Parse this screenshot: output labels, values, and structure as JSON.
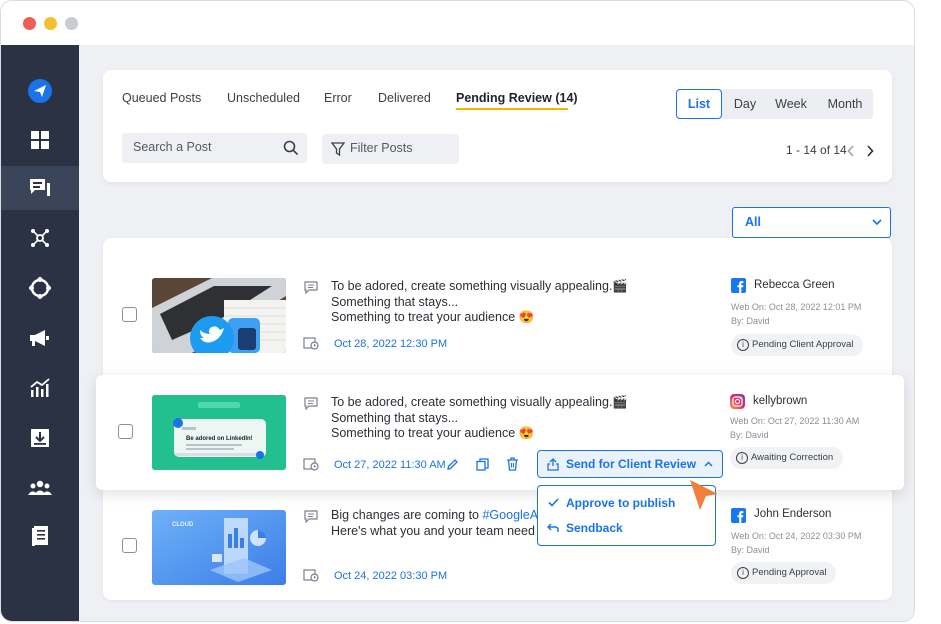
{
  "window": {
    "controls": {
      "close": "#ed5f57",
      "minimize": "#f5c02f",
      "zoom": "#c9ccd1"
    }
  },
  "sidebar": {
    "items": [
      {
        "icon": "send-icon",
        "active": false
      },
      {
        "icon": "dashboard-icon",
        "active": false
      },
      {
        "icon": "posts-icon",
        "active": true
      },
      {
        "icon": "network-icon",
        "active": false
      },
      {
        "icon": "compass-icon",
        "active": false
      },
      {
        "icon": "megaphone-icon",
        "active": false
      },
      {
        "icon": "analytics-icon",
        "active": false
      },
      {
        "icon": "inbox-download-icon",
        "active": false
      },
      {
        "icon": "team-icon",
        "active": false
      },
      {
        "icon": "document-icon",
        "active": false
      }
    ]
  },
  "tabs": [
    {
      "label": "Queued Posts",
      "active": false
    },
    {
      "label": "Unscheduled",
      "active": false
    },
    {
      "label": "Error",
      "active": false
    },
    {
      "label": "Delivered",
      "active": false
    },
    {
      "label": "Pending Review (14)",
      "active": true
    }
  ],
  "views": [
    {
      "label": "List",
      "active": true
    },
    {
      "label": "Day",
      "active": false
    },
    {
      "label": "Week",
      "active": false
    },
    {
      "label": "Month",
      "active": false
    }
  ],
  "search": {
    "placeholder": "Search a Post"
  },
  "filter": {
    "label": "Filter Posts"
  },
  "pagination": {
    "label": "1 - 14 of 14"
  },
  "account_filter": {
    "selected": "All"
  },
  "posts": [
    {
      "lines": [
        "To be adored, create something visually appealing.🎬",
        "Something that stays...",
        "Something to treat your audience 😍"
      ],
      "date": "Oct 28, 2022 12:30 PM",
      "network": "facebook",
      "account": "Rebecca Green",
      "web_on": "Web On: Oct 28, 2022 12:01 PM",
      "by": "By: David",
      "status": "Pending Client Approval"
    },
    {
      "lines": [
        "To be adored, create something visually appealing.🎬",
        "Something that stays...",
        "Something to treat your audience 😍"
      ],
      "date": "Oct 27, 2022 11:30 AM",
      "network": "instagram",
      "account": "kellybrown",
      "web_on": "Web On: Oct 27, 2022 11:30 AM",
      "by": "By: David",
      "status": "Awaiting Correction",
      "thumb_text": "Be adored on LinkedIn!",
      "action": "Send for Client Review"
    },
    {
      "lines_pre": "Big changes are coming to ",
      "hashtag": "#GoogleAna",
      "line2": "Here's what you and your team need to",
      "date": "Oct 24, 2022 03:30 PM",
      "network": "facebook",
      "account": "John Enderson",
      "web_on": "Web On: Oct 24, 2022 03:30 PM",
      "by": "By: David",
      "status": "Pending Approval",
      "thumb_text": "CLOUD"
    }
  ],
  "dropdown": {
    "items": [
      "Approve to publish",
      "Sendback"
    ]
  },
  "colors": {
    "accent": "#1a73e8",
    "sidebar": "#2a3243",
    "tab_underline": "#f5b400",
    "cursor": "#f07f3c"
  }
}
